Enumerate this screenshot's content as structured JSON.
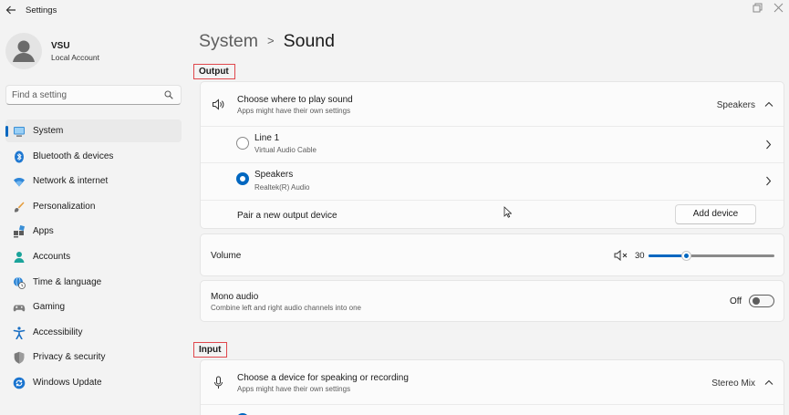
{
  "window": {
    "title": "Settings"
  },
  "user": {
    "name": "VSU",
    "account_type": "Local Account"
  },
  "search": {
    "placeholder": "Find a setting"
  },
  "sidebar": {
    "items": [
      {
        "label": "System",
        "icon": "system-icon",
        "active": true
      },
      {
        "label": "Bluetooth & devices",
        "icon": "bluetooth-icon"
      },
      {
        "label": "Network & internet",
        "icon": "wifi-icon"
      },
      {
        "label": "Personalization",
        "icon": "brush-icon"
      },
      {
        "label": "Apps",
        "icon": "apps-icon"
      },
      {
        "label": "Accounts",
        "icon": "person-icon"
      },
      {
        "label": "Time & language",
        "icon": "globe-clock-icon"
      },
      {
        "label": "Gaming",
        "icon": "gamepad-icon"
      },
      {
        "label": "Accessibility",
        "icon": "accessibility-icon"
      },
      {
        "label": "Privacy & security",
        "icon": "shield-icon"
      },
      {
        "label": "Windows Update",
        "icon": "update-icon"
      }
    ]
  },
  "breadcrumb": {
    "parent": "System",
    "separator": ">",
    "current": "Sound"
  },
  "output": {
    "header": "Output",
    "choose_title": "Choose where to play sound",
    "choose_subtitle": "Apps might have their own settings",
    "selected_device": "Speakers",
    "devices": [
      {
        "name": "Line 1",
        "detail": "Virtual Audio Cable",
        "selected": false
      },
      {
        "name": "Speakers",
        "detail": "Realtek(R) Audio",
        "selected": true
      }
    ],
    "pair_label": "Pair a new output device",
    "add_device_label": "Add device"
  },
  "volume": {
    "label": "Volume",
    "value": "30",
    "fraction": 0.3
  },
  "mono": {
    "title": "Mono audio",
    "subtitle": "Combine left and right audio channels into one",
    "state_label": "Off",
    "enabled": false
  },
  "input": {
    "header": "Input",
    "choose_title": "Choose a device for speaking or recording",
    "choose_subtitle": "Apps might have their own settings",
    "selected_device": "Stereo Mix"
  },
  "colors": {
    "accent": "#0067c0",
    "highlight_box": "#e0474c"
  }
}
